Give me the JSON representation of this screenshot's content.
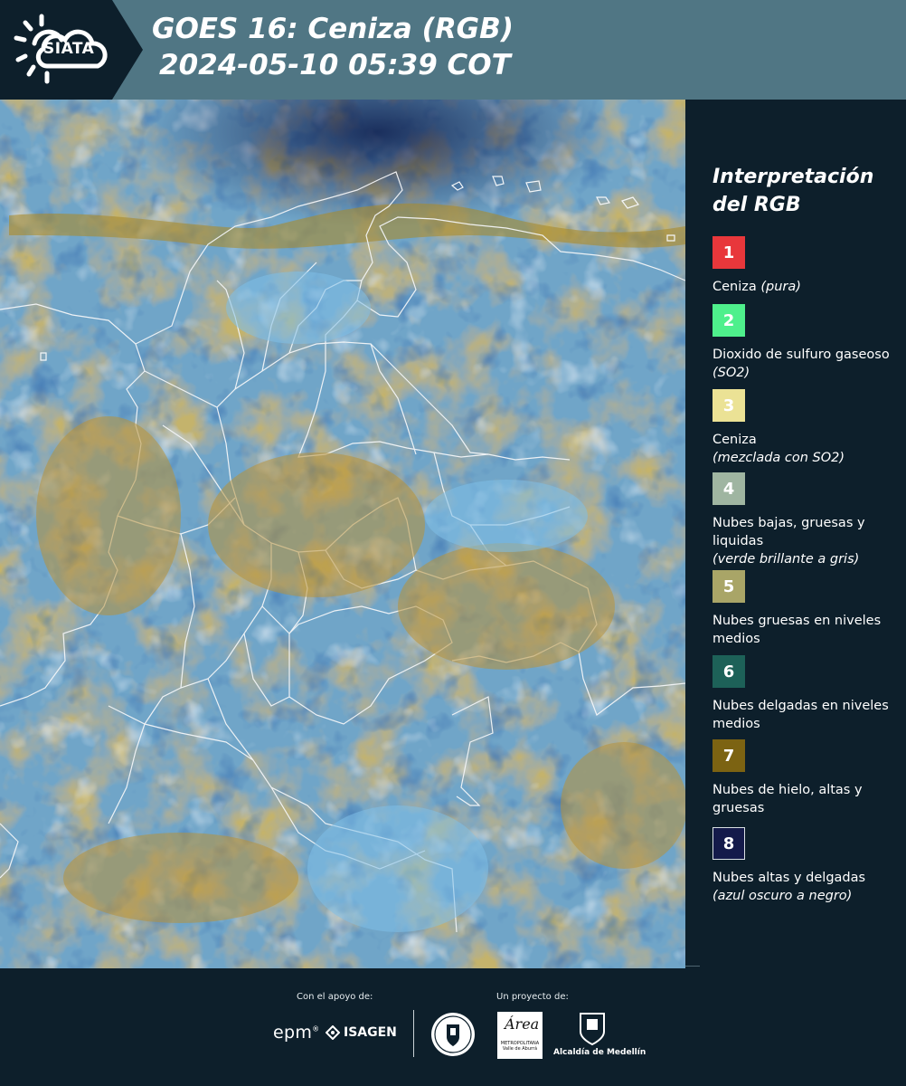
{
  "header": {
    "logo_text": "SIATA",
    "title_line1": "GOES 16: Ceniza (RGB)",
    "title_line2": "2024-05-10 05:39 COT"
  },
  "map": {
    "product": "Ceniza (RGB)",
    "satellite": "GOES 16"
  },
  "legend": {
    "title": "Interpretación del RGB",
    "items": [
      {
        "number": "1",
        "color": "#e8373b",
        "label": "Ceniza",
        "note": "(pura)"
      },
      {
        "number": "2",
        "color": "#4ef08c",
        "label": "Dioxido de sulfuro gaseoso",
        "note": "(SO2)"
      },
      {
        "number": "3",
        "color": "#ebe295",
        "label": "Ceniza",
        "note": "(mezclada con SO2)"
      },
      {
        "number": "4",
        "color": "#9fb5a1",
        "label": "Nubes bajas, gruesas y liquidas",
        "note": "(verde brillante a gris)"
      },
      {
        "number": "5",
        "color": "#a9a567",
        "label": "Nubes gruesas en niveles medios",
        "note": ""
      },
      {
        "number": "6",
        "color": "#1d6158",
        "label": "Nubes delgadas en niveles medios",
        "note": ""
      },
      {
        "number": "7",
        "color": "#7c6312",
        "label": "Nubes de hielo, altas y gruesas",
        "note": ""
      },
      {
        "number": "8",
        "color": "#141a4a",
        "label": "Nubes altas y delgadas",
        "note": "(azul oscuro a negro)"
      }
    ]
  },
  "footer": {
    "support_label": "Con el apoyo de:",
    "project_label": "Un proyecto de:",
    "epm": "epm",
    "isagen": "ISAGEN",
    "area_title": "Área",
    "area_sub": "METROPOLITANA Valle de Aburrá",
    "alcaldia": "Alcaldía de Medellín"
  }
}
